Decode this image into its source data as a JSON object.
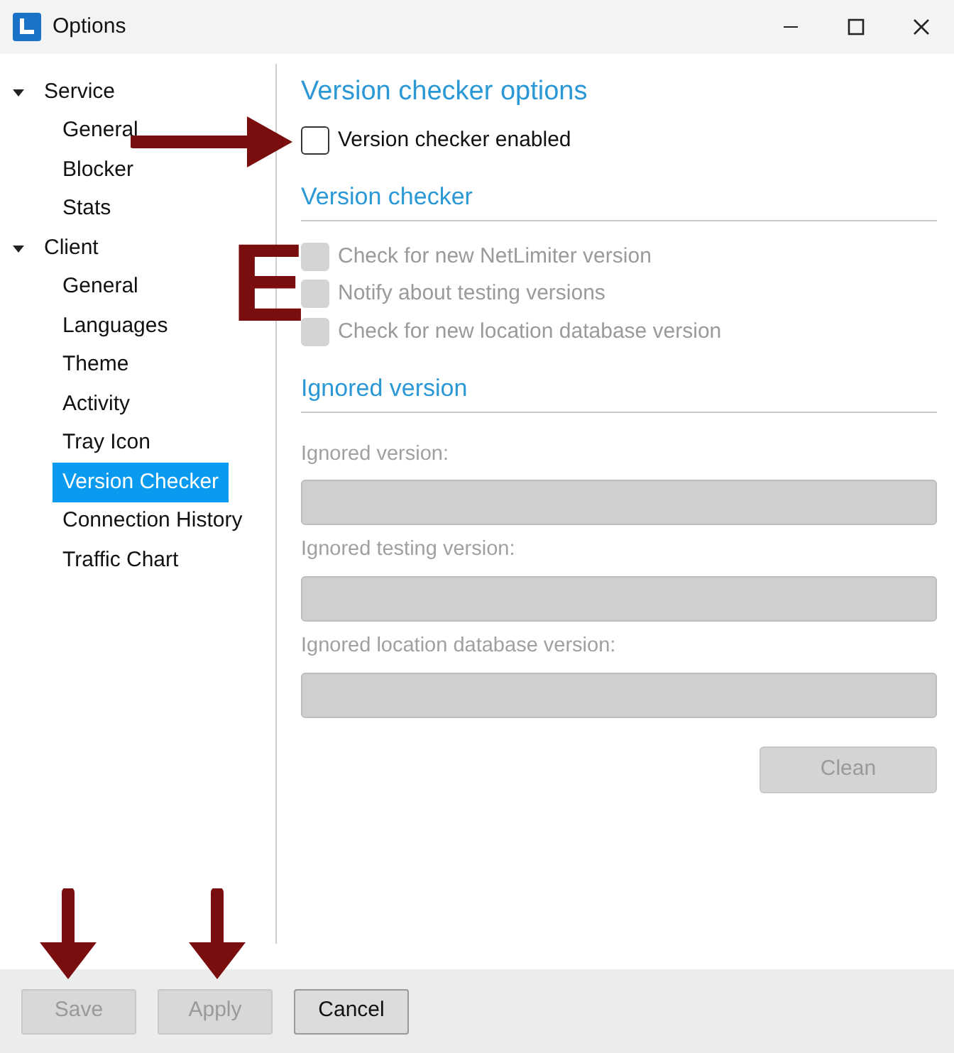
{
  "window": {
    "title": "Options"
  },
  "tree": [
    {
      "label": "Service",
      "expanded": true,
      "selected": false,
      "children": [
        {
          "label": "General",
          "selected": false
        },
        {
          "label": "Blocker",
          "selected": false
        },
        {
          "label": "Stats",
          "selected": false
        }
      ]
    },
    {
      "label": "Client",
      "expanded": true,
      "selected": false,
      "children": [
        {
          "label": "General",
          "selected": false
        },
        {
          "label": "Languages",
          "selected": false
        },
        {
          "label": "Theme",
          "selected": false
        },
        {
          "label": "Activity",
          "selected": false
        },
        {
          "label": "Tray Icon",
          "selected": false
        },
        {
          "label": "Version Checker",
          "selected": true
        },
        {
          "label": "Connection History",
          "selected": false
        },
        {
          "label": "Traffic Chart",
          "selected": false
        }
      ]
    }
  ],
  "sections": [
    {
      "title": "Version checker options",
      "kind": "title",
      "items": [
        {
          "kind": "checkbox",
          "label": "Version checker enabled",
          "checked": false,
          "disabled": false
        }
      ]
    },
    {
      "title": "Version checker",
      "kind": "heading",
      "items": [
        {
          "kind": "checkbox",
          "label": "Check for new NetLimiter version",
          "checked": false,
          "disabled": true
        },
        {
          "kind": "checkbox",
          "label": "Notify about testing versions",
          "checked": false,
          "disabled": true
        },
        {
          "kind": "checkbox",
          "label": "Check for new location database version",
          "checked": false,
          "disabled": true
        }
      ]
    },
    {
      "title": "Ignored version",
      "kind": "heading",
      "items": [
        {
          "kind": "field",
          "label": "Ignored version:",
          "disabled": true
        },
        {
          "kind": "field",
          "label": "Ignored testing version:",
          "disabled": true
        },
        {
          "kind": "field",
          "label": "Ignored location database version:",
          "disabled": true
        },
        {
          "kind": "button",
          "label": "Clean",
          "disabled": true
        }
      ]
    }
  ],
  "footer_buttons": [
    {
      "label": "Save",
      "disabled": true
    },
    {
      "label": "Apply",
      "disabled": true
    },
    {
      "label": "Cancel",
      "disabled": false
    }
  ],
  "annotations": [
    {
      "kind": "arrow_right"
    },
    {
      "kind": "letter",
      "text": "E"
    },
    {
      "kind": "arrow_down"
    },
    {
      "kind": "arrow_down"
    }
  ]
}
